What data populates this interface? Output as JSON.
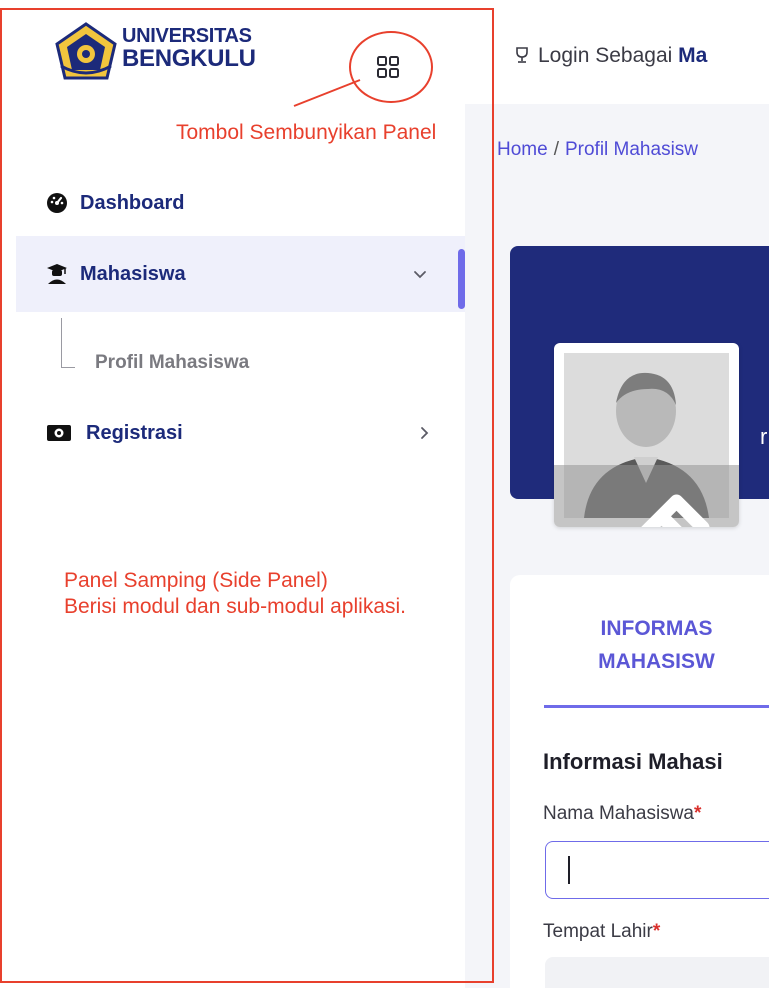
{
  "brand": {
    "line1": "UNIVERSITAS",
    "line2": "BENGKULU",
    "colors": {
      "navy": "#1c2a7a",
      "gold": "#f2c53d",
      "accent": "#6f6be9"
    }
  },
  "header": {
    "login_prefix": "Login Sebagai",
    "login_role": "Ma"
  },
  "sidebar": {
    "toggle_icon": "grid-icon",
    "items": [
      {
        "label": "Dashboard",
        "icon": "dashboard-icon"
      },
      {
        "label": "Mahasiswa",
        "icon": "graduate-icon",
        "active": true,
        "expanded": true
      },
      {
        "label": "Registrasi",
        "icon": "money-icon"
      }
    ],
    "submenu": [
      {
        "label": "Profil Mahasiswa"
      }
    ]
  },
  "breadcrumb": {
    "home": "Home",
    "separator": "/",
    "current": "Profil Mahasisw"
  },
  "hero": {
    "letter": "r"
  },
  "card": {
    "tab_label_line1": "INFORMAS",
    "tab_label_line2": "MAHASISW",
    "section_title": "Informasi Mahasi",
    "fields": [
      {
        "label": "Nama Mahasiswa",
        "required_mark": "*",
        "value": ""
      },
      {
        "label": "Tempat Lahir",
        "required_mark": "*",
        "value": ""
      }
    ]
  },
  "annotations": {
    "toggle_note": "Tombol Sembunyikan Panel",
    "panel_note_line1": "Panel Samping (Side Panel)",
    "panel_note_line2": "Berisi modul dan sub-modul aplikasi.",
    "color": "#e8402d"
  }
}
